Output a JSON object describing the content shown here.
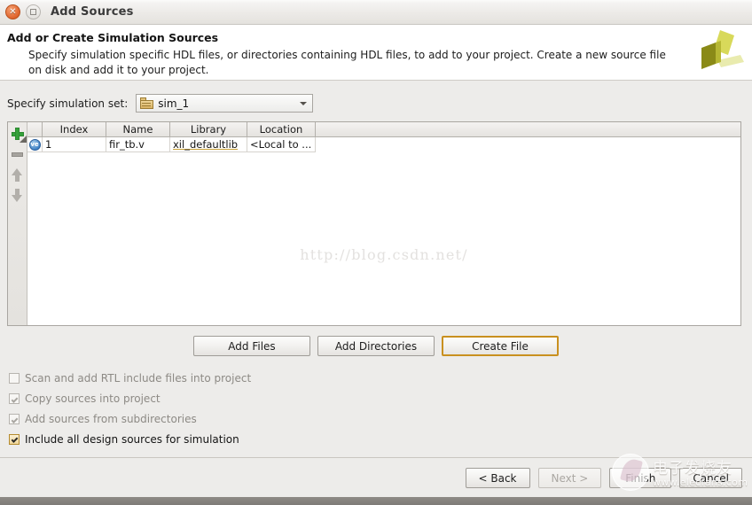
{
  "window": {
    "title": "Add Sources",
    "close_icon": "close-icon",
    "maximize_icon": "maximize-icon"
  },
  "header": {
    "title": "Add or Create Simulation Sources",
    "description": "Specify simulation specific HDL files, or directories containing HDL files, to add to your project. Create a new source file on disk and add it to your project.",
    "logo": "xilinx-logo",
    "logo_colors": [
      "#d8d95a",
      "#8a8a17",
      "#e9ebae"
    ]
  },
  "simset": {
    "label": "Specify simulation set:",
    "value": "sim_1",
    "icon": "folder-icon",
    "dropdown_icon": "chevron-down-icon"
  },
  "table_toolbar": {
    "add_icon": "plus-icon",
    "remove_icon": "minus-icon",
    "move_up_icon": "arrow-up-icon",
    "move_down_icon": "arrow-down-icon"
  },
  "table": {
    "columns": [
      "Index",
      "Name",
      "Library",
      "Location"
    ],
    "rows": [
      {
        "icon": "verilog-file-icon",
        "icon_label": "ve",
        "index": "1",
        "name": "fir_tb.v",
        "library": "xil_defaultlib",
        "location": "<Local to ..."
      }
    ]
  },
  "watermarks": {
    "center": "http://blog.csdn.net/",
    "corner_cn": "电子发烧友",
    "corner_url": "www.elecfans.com"
  },
  "actions": {
    "add_files": "Add Files",
    "add_directories": "Add Directories",
    "create_file": "Create File"
  },
  "checkboxes": [
    {
      "label": "Scan and add RTL include files into project",
      "checked": false,
      "enabled": false
    },
    {
      "label": "Copy sources into project",
      "checked": true,
      "enabled": false
    },
    {
      "label": "Add sources from subdirectories",
      "checked": true,
      "enabled": false
    },
    {
      "label": "Include all design sources for simulation",
      "checked": true,
      "enabled": true
    }
  ],
  "footer": {
    "back": "< Back",
    "next": "Next >",
    "finish": "Finish",
    "cancel": "Cancel"
  },
  "colors": {
    "accent_focus": "#c9901f",
    "window_bg": "#edecea",
    "header_bg": "#ffffff",
    "close_button": "#e0642c"
  }
}
